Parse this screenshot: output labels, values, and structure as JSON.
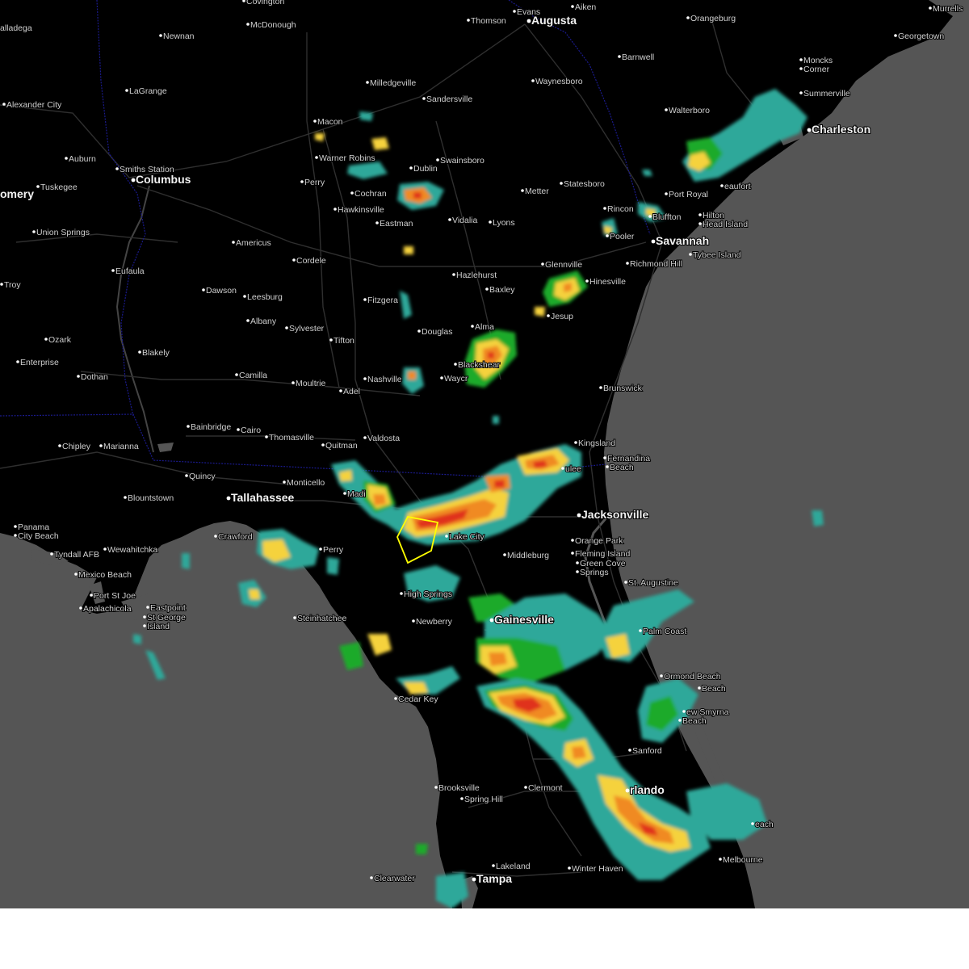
{
  "map": {
    "colors": {
      "land": "#000000",
      "water": "#555555",
      "page": "#ffffff",
      "roads": "#2f2f2f",
      "state_border": "#1a1a8c",
      "labels": "#d0d0d0",
      "warning_polygon": "#ffff00",
      "radar_light": "#2fa89a",
      "radar_green": "#1faa2a",
      "radar_yellow": "#f5d23c",
      "radar_orange": "#f08a24",
      "radar_red": "#e0301e"
    },
    "cities": [
      {
        "id": "covington",
        "name": "Covington",
        "big": false
      },
      {
        "id": "evans",
        "name": "Evans",
        "big": false
      },
      {
        "id": "aiken",
        "name": "Aiken",
        "big": false
      },
      {
        "id": "murrells",
        "name": "Murrells",
        "big": false
      },
      {
        "id": "talladega",
        "name": "alladega",
        "big": false
      },
      {
        "id": "mcdonough",
        "name": "McDonough",
        "big": false
      },
      {
        "id": "thomson",
        "name": "Thomson",
        "big": false
      },
      {
        "id": "augusta",
        "name": "Augusta",
        "big": true
      },
      {
        "id": "orangeburg",
        "name": "Orangeburg",
        "big": false
      },
      {
        "id": "newnan",
        "name": "Newnan",
        "big": false
      },
      {
        "id": "georgetown",
        "name": "Georgetown",
        "big": false
      },
      {
        "id": "barnwell",
        "name": "Barnwell",
        "big": false
      },
      {
        "id": "moncks",
        "name": "Moncks",
        "big": false
      },
      {
        "id": "corner",
        "name": "Corner",
        "big": false
      },
      {
        "id": "milledgeville",
        "name": "Milledgeville",
        "big": false
      },
      {
        "id": "waynesboro",
        "name": "Waynesboro",
        "big": false
      },
      {
        "id": "lagrange",
        "name": "LaGrange",
        "big": false
      },
      {
        "id": "summerville",
        "name": "Summerville",
        "big": false
      },
      {
        "id": "sandersville",
        "name": "Sandersville",
        "big": false
      },
      {
        "id": "alexandercity",
        "name": "Alexander City",
        "big": false
      },
      {
        "id": "walterboro",
        "name": "Walterboro",
        "big": false
      },
      {
        "id": "macon",
        "name": "Macon",
        "big": false
      },
      {
        "id": "charleston",
        "name": "Charleston",
        "big": true
      },
      {
        "id": "auburn",
        "name": "Auburn",
        "big": false
      },
      {
        "id": "warnerrobins",
        "name": "Warner Robins",
        "big": false
      },
      {
        "id": "swainsboro",
        "name": "Swainsboro",
        "big": false
      },
      {
        "id": "smithsstation",
        "name": "Smiths Station",
        "big": false
      },
      {
        "id": "columbus",
        "name": "Columbus",
        "big": true
      },
      {
        "id": "dublin",
        "name": "Dublin",
        "big": false
      },
      {
        "id": "tuskegee",
        "name": "Tuskegee",
        "big": false
      },
      {
        "id": "perry",
        "name": "Perry",
        "big": false
      },
      {
        "id": "statesboro",
        "name": "Statesboro",
        "big": false
      },
      {
        "id": "beaufort",
        "name": "eaufort",
        "big": false
      },
      {
        "id": "montgomery",
        "name": "omery",
        "big": true
      },
      {
        "id": "cochran",
        "name": "Cochran",
        "big": false
      },
      {
        "id": "metter",
        "name": "Metter",
        "big": false
      },
      {
        "id": "portroyal",
        "name": "Port Royal",
        "big": false
      },
      {
        "id": "hawkinsville",
        "name": "Hawkinsville",
        "big": false
      },
      {
        "id": "rincon",
        "name": "Rincon",
        "big": false
      },
      {
        "id": "bluffton",
        "name": "Bluffton",
        "big": false
      },
      {
        "id": "hilton",
        "name": "Hilton",
        "big": false
      },
      {
        "id": "vidalia",
        "name": "Vidalia",
        "big": false
      },
      {
        "id": "lyons",
        "name": "Lyons",
        "big": false
      },
      {
        "id": "eastman",
        "name": "Eastman",
        "big": false
      },
      {
        "id": "headisland",
        "name": "Head Island",
        "big": false
      },
      {
        "id": "unionsprings",
        "name": "Union Springs",
        "big": false
      },
      {
        "id": "pooler",
        "name": "Pooler",
        "big": false
      },
      {
        "id": "savannah",
        "name": "Savannah",
        "big": true
      },
      {
        "id": "americus",
        "name": "Americus",
        "big": false
      },
      {
        "id": "tybee",
        "name": "Tybee Island",
        "big": false
      },
      {
        "id": "cordele",
        "name": "Cordele",
        "big": false
      },
      {
        "id": "richmondhill",
        "name": "Richmond Hill",
        "big": false
      },
      {
        "id": "glennville",
        "name": "Glennville",
        "big": false
      },
      {
        "id": "eufaula",
        "name": "Eufaula",
        "big": false
      },
      {
        "id": "hazlehurst",
        "name": "Hazlehurst",
        "big": false
      },
      {
        "id": "hinesville",
        "name": "Hinesville",
        "big": false
      },
      {
        "id": "troy",
        "name": "Troy",
        "big": false
      },
      {
        "id": "dawson",
        "name": "Dawson",
        "big": false
      },
      {
        "id": "baxley",
        "name": "Baxley",
        "big": false
      },
      {
        "id": "leesburg",
        "name": "Leesburg",
        "big": false
      },
      {
        "id": "fitzgerald",
        "name": "Fitzgera",
        "big": false
      },
      {
        "id": "jesup",
        "name": "Jesup",
        "big": false
      },
      {
        "id": "albany",
        "name": "Albany",
        "big": false
      },
      {
        "id": "alma",
        "name": "Alma",
        "big": false
      },
      {
        "id": "sylvester",
        "name": "Sylvester",
        "big": false
      },
      {
        "id": "douglas",
        "name": "Douglas",
        "big": false
      },
      {
        "id": "ozark",
        "name": "Ozark",
        "big": false
      },
      {
        "id": "tifton",
        "name": "Tifton",
        "big": false
      },
      {
        "id": "blakely",
        "name": "Blakely",
        "big": false
      },
      {
        "id": "blackshear",
        "name": "Blackshear",
        "big": false
      },
      {
        "id": "enterprise",
        "name": "Enterprise",
        "big": false
      },
      {
        "id": "nashville",
        "name": "Nashville",
        "big": false
      },
      {
        "id": "dothan",
        "name": "Dothan",
        "big": false
      },
      {
        "id": "camilla",
        "name": "Camilla",
        "big": false
      },
      {
        "id": "waycross",
        "name": "Waycr",
        "big": false
      },
      {
        "id": "moultrie",
        "name": "Moultrie",
        "big": false
      },
      {
        "id": "brunswick",
        "name": "Brunswick",
        "big": false
      },
      {
        "id": "adel",
        "name": "Adel",
        "big": false
      },
      {
        "id": "bainbridge",
        "name": "Bainbridge",
        "big": false
      },
      {
        "id": "cairo",
        "name": "Cairo",
        "big": false
      },
      {
        "id": "thomasville",
        "name": "Thomasville",
        "big": false
      },
      {
        "id": "valdosta",
        "name": "Valdosta",
        "big": false
      },
      {
        "id": "kingsland",
        "name": "Kingsland",
        "big": false
      },
      {
        "id": "quitman",
        "name": "Quitman",
        "big": false
      },
      {
        "id": "chipley",
        "name": "Chipley",
        "big": false
      },
      {
        "id": "marianna",
        "name": "Marianna",
        "big": false
      },
      {
        "id": "fernandina",
        "name": "Fernandina",
        "big": false
      },
      {
        "id": "beach1",
        "name": "Beach",
        "big": false
      },
      {
        "id": "yulee",
        "name": "ulee",
        "big": false
      },
      {
        "id": "quincy",
        "name": "Quincy",
        "big": false
      },
      {
        "id": "monticello",
        "name": "Monticello",
        "big": false
      },
      {
        "id": "madison",
        "name": "Madi",
        "big": false
      },
      {
        "id": "blountstown",
        "name": "Blountstown",
        "big": false
      },
      {
        "id": "tallahassee",
        "name": "Tallahassee",
        "big": true
      },
      {
        "id": "jacksonville",
        "name": "Jacksonville",
        "big": true
      },
      {
        "id": "panamacity",
        "name": "Panama",
        "big": false
      },
      {
        "id": "citybeach",
        "name": "City Beach",
        "big": false
      },
      {
        "id": "crawford",
        "name": "Crawford",
        "big": false
      },
      {
        "id": "lakecity",
        "name": "Lake City",
        "big": false
      },
      {
        "id": "orangepark",
        "name": "Orange Park",
        "big": false
      },
      {
        "id": "perryfl",
        "name": "Perry",
        "big": false
      },
      {
        "id": "tyndall",
        "name": "Tyndall AFB",
        "big": false
      },
      {
        "id": "wewahitchka",
        "name": "Wewahitchka",
        "big": false
      },
      {
        "id": "middleburg",
        "name": "Middleburg",
        "big": false
      },
      {
        "id": "flemingisland",
        "name": "Fleming Island",
        "big": false
      },
      {
        "id": "greencove",
        "name": "Green Cove",
        "big": false
      },
      {
        "id": "springs",
        "name": "Springs",
        "big": false
      },
      {
        "id": "mexicobeach",
        "name": "Mexico Beach",
        "big": false
      },
      {
        "id": "staugustine",
        "name": "St. Augustine",
        "big": false
      },
      {
        "id": "portstjoe",
        "name": "Port St Joe",
        "big": false
      },
      {
        "id": "eastpoint",
        "name": "Eastpoint",
        "big": false
      },
      {
        "id": "highsprings",
        "name": "High Springs",
        "big": false
      },
      {
        "id": "apalachicola",
        "name": "Apalachicola",
        "big": false
      },
      {
        "id": "stgeorge",
        "name": "St George",
        "big": false
      },
      {
        "id": "island",
        "name": "Island",
        "big": false
      },
      {
        "id": "steinhatchee",
        "name": "Steinhatchee",
        "big": false
      },
      {
        "id": "newberry",
        "name": "Newberry",
        "big": false
      },
      {
        "id": "gainesville",
        "name": "Gainesville",
        "big": true
      },
      {
        "id": "palmcoast",
        "name": "Palm Coast",
        "big": false
      },
      {
        "id": "ormondbeach",
        "name": "Ormond Beach",
        "big": false
      },
      {
        "id": "daytonabeach",
        "name": "Beach",
        "big": false
      },
      {
        "id": "cedarkey",
        "name": "Cedar Key",
        "big": false
      },
      {
        "id": "newsmyrna",
        "name": "ew Smyrna",
        "big": false
      },
      {
        "id": "beach2",
        "name": "Beach",
        "big": false
      },
      {
        "id": "sanford",
        "name": "Sanford",
        "big": false
      },
      {
        "id": "brooksville",
        "name": "Brooksville",
        "big": false
      },
      {
        "id": "clermont",
        "name": "Clermont",
        "big": false
      },
      {
        "id": "orlando",
        "name": "rlando",
        "big": true
      },
      {
        "id": "springhill",
        "name": "Spring Hill",
        "big": false
      },
      {
        "id": "cocoabeach",
        "name": "each",
        "big": false
      },
      {
        "id": "lakeland",
        "name": "Lakeland",
        "big": false
      },
      {
        "id": "winterhaven",
        "name": "Winter Haven",
        "big": false
      },
      {
        "id": "melbourne",
        "name": "Melbourne",
        "big": false
      },
      {
        "id": "clearwater",
        "name": "Clearwater",
        "big": false
      },
      {
        "id": "tampa",
        "name": "Tampa",
        "big": true
      }
    ]
  }
}
